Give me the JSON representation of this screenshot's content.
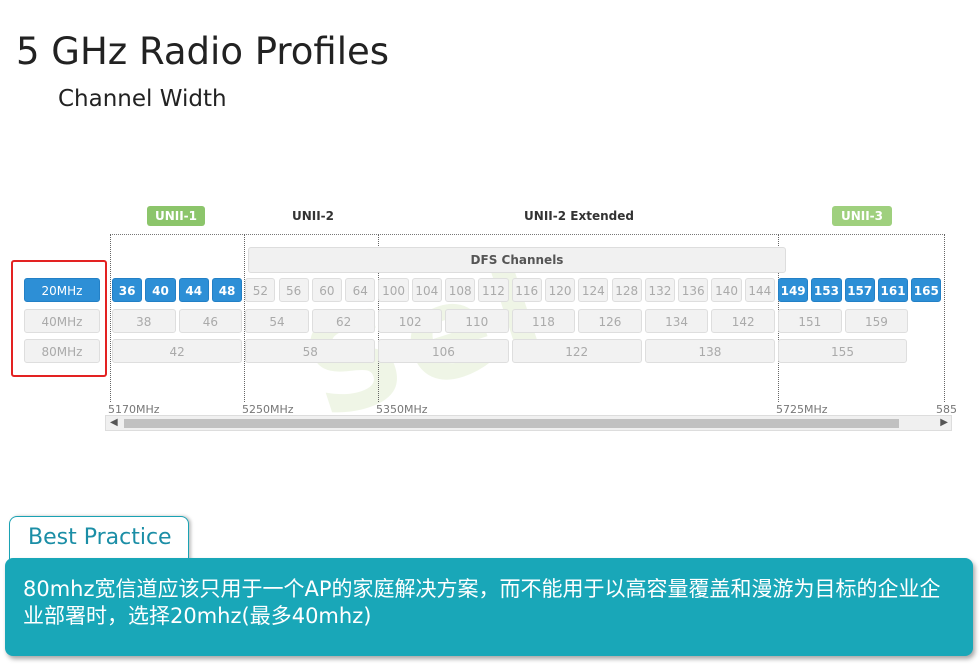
{
  "title": "5 GHz Radio Profiles",
  "subtitle": "Channel Width",
  "bands": {
    "unii1": "UNII-1",
    "unii2": "UNII-2",
    "unii2e": "UNII-2 Extended",
    "unii3": "UNII-3"
  },
  "dfs_label": "DFS Channels",
  "widths": [
    "20MHz",
    "40MHz",
    "80MHz"
  ],
  "channels_20": [
    "36",
    "40",
    "44",
    "48",
    "52",
    "56",
    "60",
    "64",
    "100",
    "104",
    "108",
    "112",
    "116",
    "120",
    "124",
    "128",
    "132",
    "136",
    "140",
    "144",
    "149",
    "153",
    "157",
    "161",
    "165"
  ],
  "channels_40": [
    "38",
    "46",
    "54",
    "62",
    "102",
    "110",
    "118",
    "126",
    "134",
    "142",
    "151",
    "159"
  ],
  "channels_80": [
    "42",
    "58",
    "106",
    "122",
    "138",
    "155"
  ],
  "frequencies": [
    "5170MHz",
    "5250MHz",
    "5350MHz",
    "5725MHz",
    "585"
  ],
  "best_practice": {
    "heading": "Best Practice",
    "text": "80mhz宽信道应该只用于一个AP的家庭解决方案，而不能用于以高容量覆盖和漫游为目标的企业企业部署时，选择20mhz(最多40mhz)"
  },
  "colors": {
    "accent": "#2d8fd6",
    "green": "#8cc56b",
    "teal": "#19a7b8",
    "highlight": "#e32222"
  }
}
